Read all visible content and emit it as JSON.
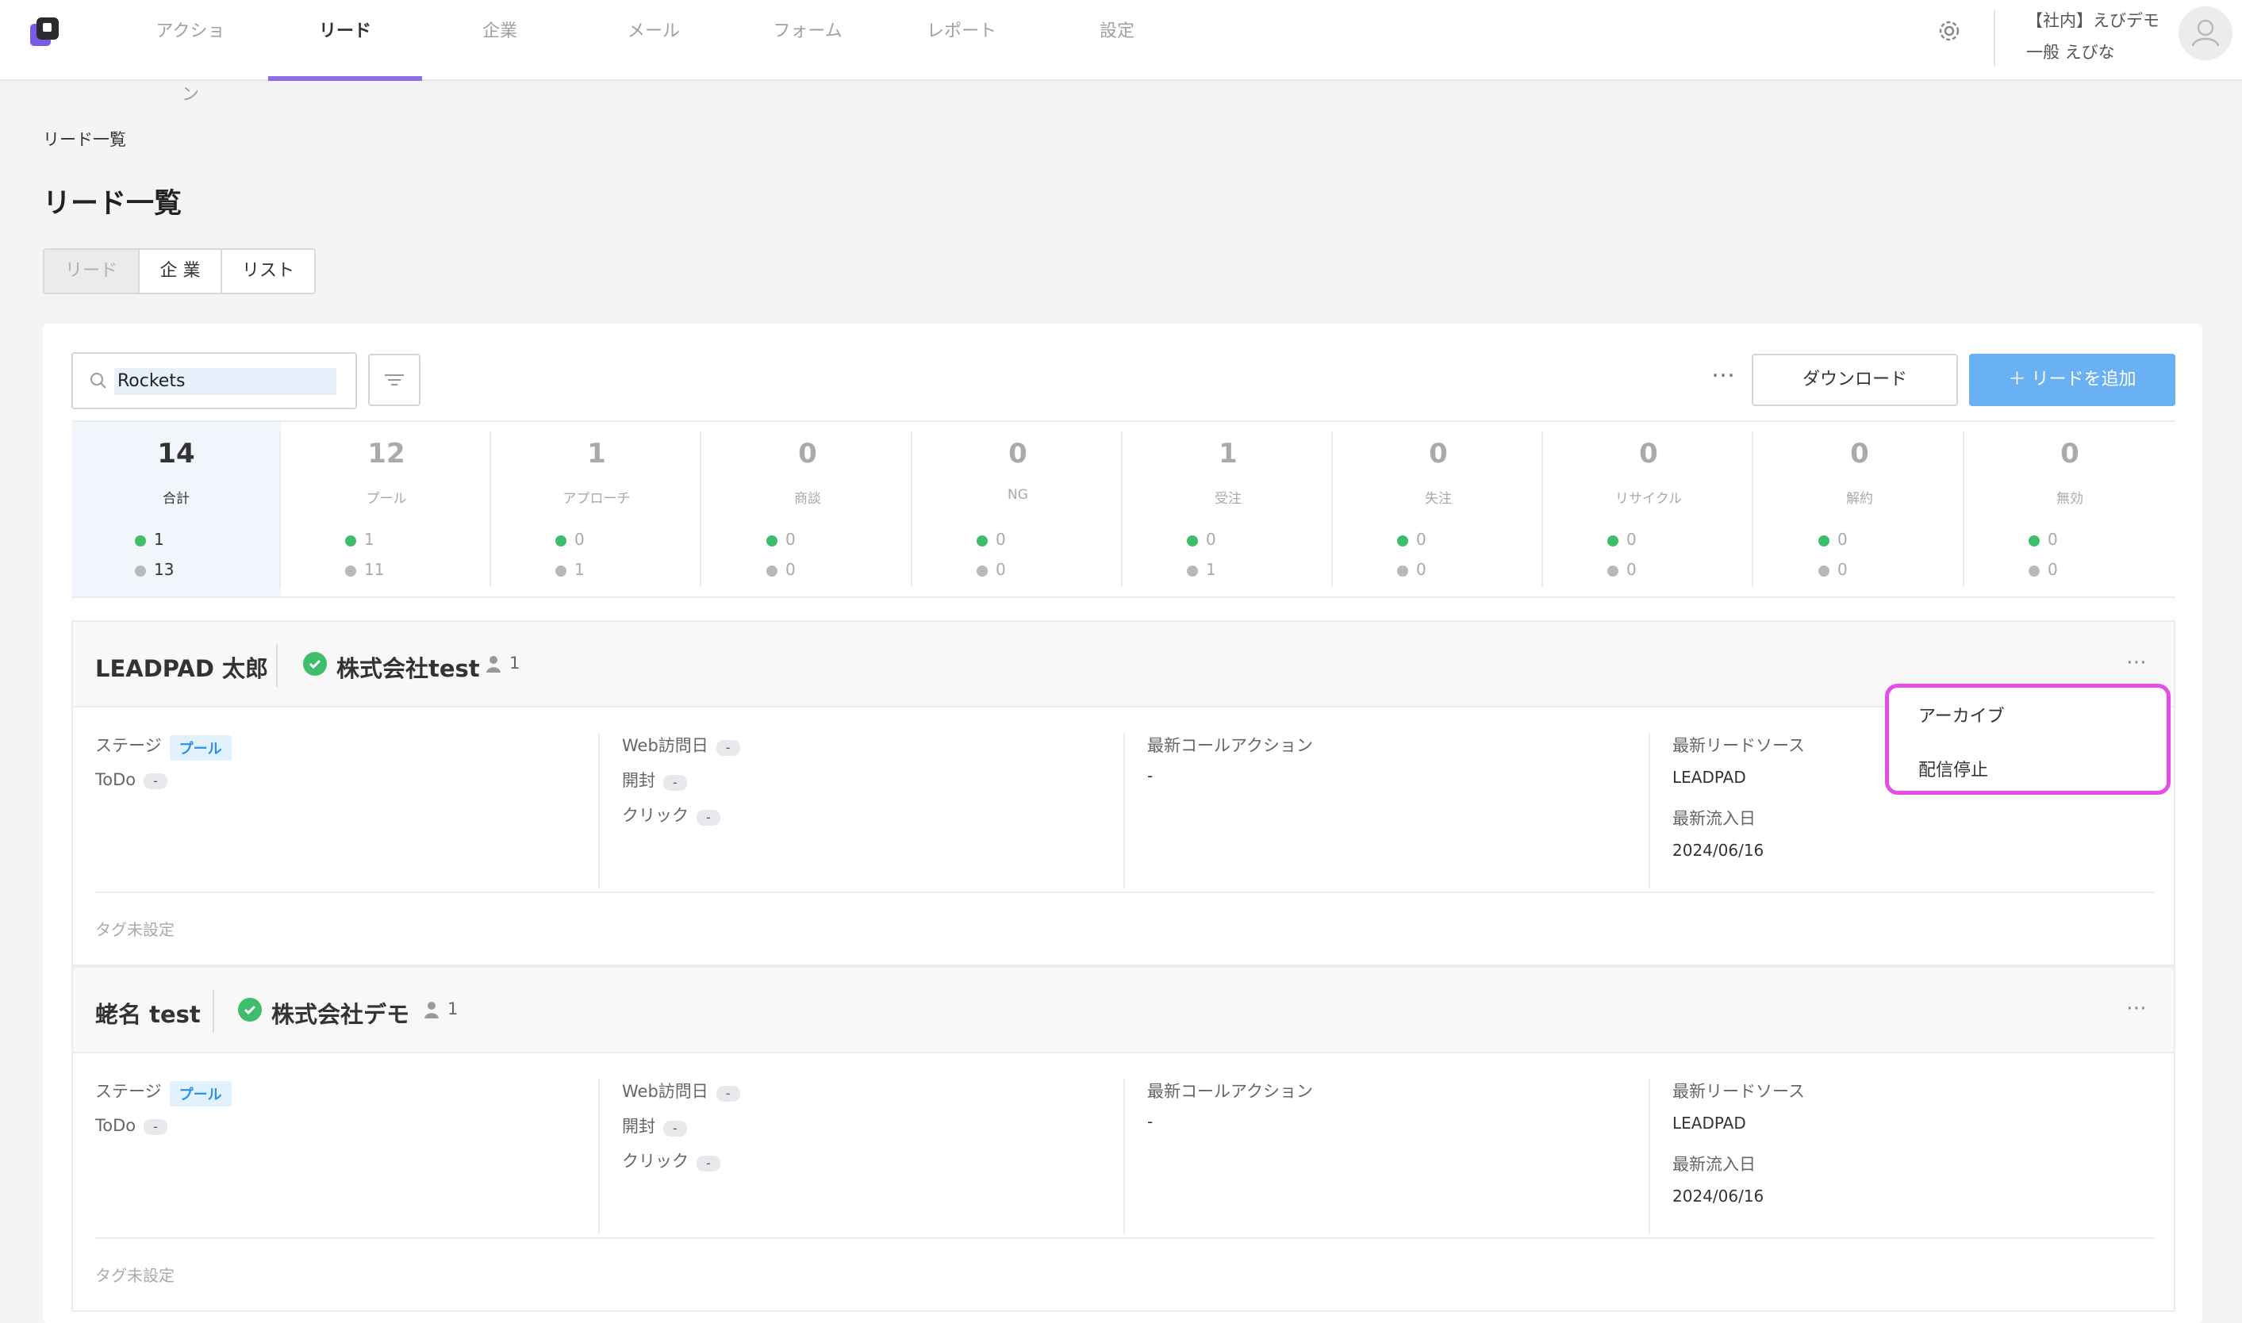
{
  "header": {
    "nav": [
      {
        "label": "アクション",
        "active": false
      },
      {
        "label": "リード",
        "active": true
      },
      {
        "label": "企業",
        "active": false
      },
      {
        "label": "メール",
        "active": false
      },
      {
        "label": "フォーム",
        "active": false
      },
      {
        "label": "レポート",
        "active": false
      },
      {
        "label": "設定",
        "active": false
      }
    ],
    "user_org": "【社内】えびデモ",
    "user_name": "一般 えびな"
  },
  "breadcrumb": "リード一覧",
  "page_title": "リード一覧",
  "segments": [
    {
      "label": "リード",
      "selected": true
    },
    {
      "label": "企 業",
      "selected": false
    },
    {
      "label": "リスト",
      "selected": false
    }
  ],
  "toolbar": {
    "search_value": "Rockets",
    "more": "…",
    "download": "ダウンロード",
    "add": "＋ リードを追加"
  },
  "stats": [
    {
      "count": "14",
      "label": "合計",
      "active": "1",
      "inactive": "13"
    },
    {
      "count": "12",
      "label": "プール",
      "active": "1",
      "inactive": "11"
    },
    {
      "count": "1",
      "label": "アプローチ",
      "active": "0",
      "inactive": "1"
    },
    {
      "count": "0",
      "label": "商談",
      "active": "0",
      "inactive": "0"
    },
    {
      "count": "0",
      "label": "NG",
      "active": "0",
      "inactive": "0"
    },
    {
      "count": "1",
      "label": "受注",
      "active": "0",
      "inactive": "1"
    },
    {
      "count": "0",
      "label": "失注",
      "active": "0",
      "inactive": "0"
    },
    {
      "count": "0",
      "label": "リサイクル",
      "active": "0",
      "inactive": "0"
    },
    {
      "count": "0",
      "label": "解約",
      "active": "0",
      "inactive": "0"
    },
    {
      "count": "0",
      "label": "無効",
      "active": "0",
      "inactive": "0"
    }
  ],
  "colors": {
    "accent": "#8f6ce6",
    "primary": "#6ab1f3",
    "active_dot": "#3ebd6a",
    "inactive_dot": "#b9b9bd",
    "menu_outline": "#e94be8"
  },
  "leads": [
    {
      "name": "LEADPAD 太郎",
      "company": "株式会社test",
      "people": "1",
      "stage_label": "ステージ",
      "stage": "プール",
      "todo_label": "ToDo",
      "todo": "-",
      "web_label": "Web訪問日",
      "web": "-",
      "open_label": "開封",
      "open": "-",
      "click_label": "クリック",
      "click": "-",
      "call_label": "最新コールアクション",
      "call": "-",
      "source_label": "最新リードソース",
      "source": "LEADPAD",
      "inflow_label": "最新流入日",
      "inflow": "2024/06/16",
      "tags": "タグ未設定"
    },
    {
      "name": "蛯名 test",
      "company": "株式会社デモ",
      "people": "1",
      "stage_label": "ステージ",
      "stage": "プール",
      "todo_label": "ToDo",
      "todo": "-",
      "web_label": "Web訪問日",
      "web": "-",
      "open_label": "開封",
      "open": "-",
      "click_label": "クリック",
      "click": "-",
      "call_label": "最新コールアクション",
      "call": "-",
      "source_label": "最新リードソース",
      "source": "LEADPAD",
      "inflow_label": "最新流入日",
      "inflow": "2024/06/16",
      "tags": "タグ未設定"
    }
  ],
  "menu": {
    "archive": "アーカイブ",
    "unsubscribe": "配信停止"
  }
}
